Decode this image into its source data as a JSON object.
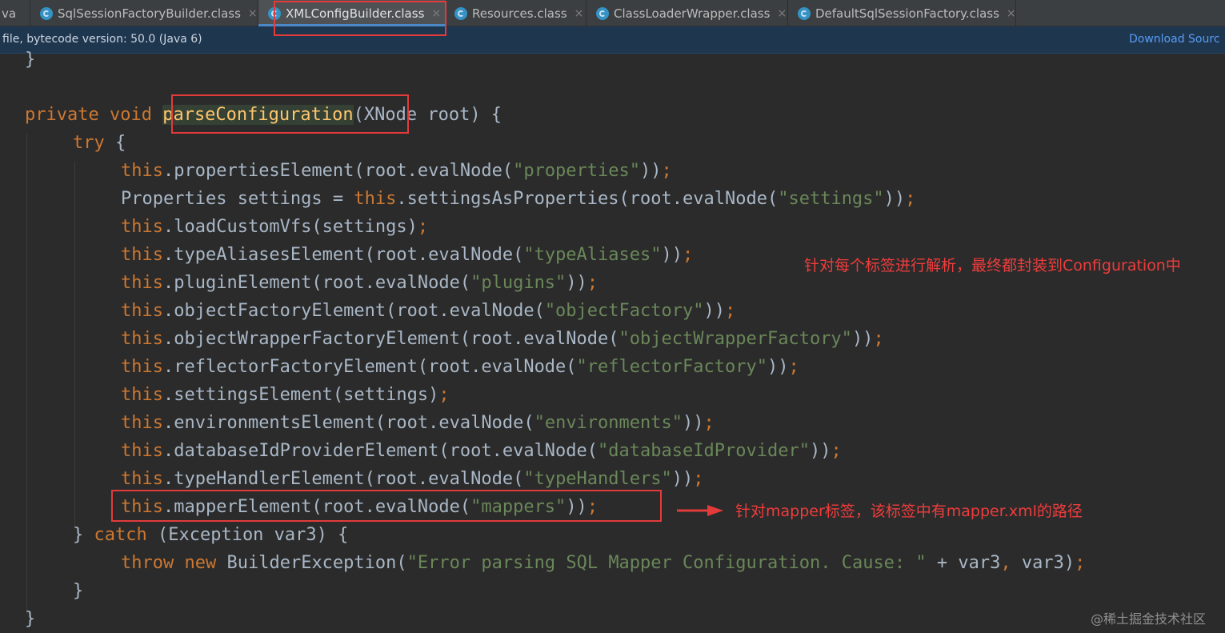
{
  "tabs": [
    {
      "label": "va",
      "icon": "none"
    },
    {
      "label": "SqlSessionFactoryBuilder.class",
      "icon": "class-file-icon"
    },
    {
      "label": "XMLConfigBuilder.class",
      "icon": "class-file-icon",
      "active": true
    },
    {
      "label": "Resources.class",
      "icon": "class-file-icon"
    },
    {
      "label": "ClassLoaderWrapper.class",
      "icon": "class-file-icon"
    },
    {
      "label": "DefaultSqlSessionFactory.class",
      "icon": "class-file-icon"
    }
  ],
  "tab_close_glyph": "×",
  "banner": {
    "text": "file, bytecode version: 50.0 (Java 6)",
    "link": "Download Sourc"
  },
  "code": {
    "closing_brace_top": "}",
    "method_decl": {
      "kw1": "private",
      "kw2": "void",
      "name": "parseConfiguration",
      "params": "(XNode root) {"
    },
    "try_line": {
      "kw": "try",
      "rest": " {"
    },
    "statements": [
      {
        "this": "this",
        "call": ".propertiesElement(root.evalNode(",
        "arg": "\"properties\"",
        "end": "))",
        "semi": ";"
      },
      {
        "prefix": "Properties settings = ",
        "this": "this",
        "call": ".settingsAsProperties(root.evalNode(",
        "arg": "\"settings\"",
        "end": "))",
        "semi": ";"
      },
      {
        "this": "this",
        "call": ".loadCustomVfs(settings)",
        "arg": "",
        "end": "",
        "semi": ";"
      },
      {
        "this": "this",
        "call": ".typeAliasesElement(root.evalNode(",
        "arg": "\"typeAliases\"",
        "end": "))",
        "semi": ";"
      },
      {
        "this": "this",
        "call": ".pluginElement(root.evalNode(",
        "arg": "\"plugins\"",
        "end": "))",
        "semi": ";"
      },
      {
        "this": "this",
        "call": ".objectFactoryElement(root.evalNode(",
        "arg": "\"objectFactory\"",
        "end": "))",
        "semi": ";"
      },
      {
        "this": "this",
        "call": ".objectWrapperFactoryElement(root.evalNode(",
        "arg": "\"objectWrapperFactory\"",
        "end": "))",
        "semi": ";"
      },
      {
        "this": "this",
        "call": ".reflectorFactoryElement(root.evalNode(",
        "arg": "\"reflectorFactory\"",
        "end": "))",
        "semi": ";"
      },
      {
        "this": "this",
        "call": ".settingsElement(settings)",
        "arg": "",
        "end": "",
        "semi": ";"
      },
      {
        "this": "this",
        "call": ".environmentsElement(root.evalNode(",
        "arg": "\"environments\"",
        "end": "))",
        "semi": ";"
      },
      {
        "this": "this",
        "call": ".databaseIdProviderElement(root.evalNode(",
        "arg": "\"databaseIdProvider\"",
        "end": "))",
        "semi": ";"
      },
      {
        "this": "this",
        "call": ".typeHandlerElement(root.evalNode(",
        "arg": "\"typeHandlers\"",
        "end": "))",
        "semi": ";"
      },
      {
        "this": "this",
        "call": ".mapperElement(root.evalNode(",
        "arg": "\"mappers\"",
        "end": "))",
        "semi": ";"
      }
    ],
    "catch_line": {
      "brace": "} ",
      "kw": "catch",
      "rest": " (Exception var3) {"
    },
    "throw_line": {
      "kw1": "throw",
      "kw2": "new",
      "cls": " BuilderException(",
      "str": "\"Error parsing SQL Mapper Configuration. Cause: \"",
      "rest": " + var3",
      "comma": ",",
      "rest2": " var3)",
      "semi": ";"
    },
    "close_catch": "}",
    "close_method": "}"
  },
  "annotations": {
    "note_parse": "针对每个标签进行解析，最终都封装到Configuration中",
    "note_mapper": "针对mapper标签，该标签中有mapper.xml的路径",
    "arrow_icon": "right-arrow-icon"
  },
  "watermark": "@稀土掘金技术社区",
  "colors": {
    "keyword": "#cc7832",
    "string": "#6a8759",
    "method_decl": "#ffc66d",
    "annotation": "#e33b3b"
  }
}
